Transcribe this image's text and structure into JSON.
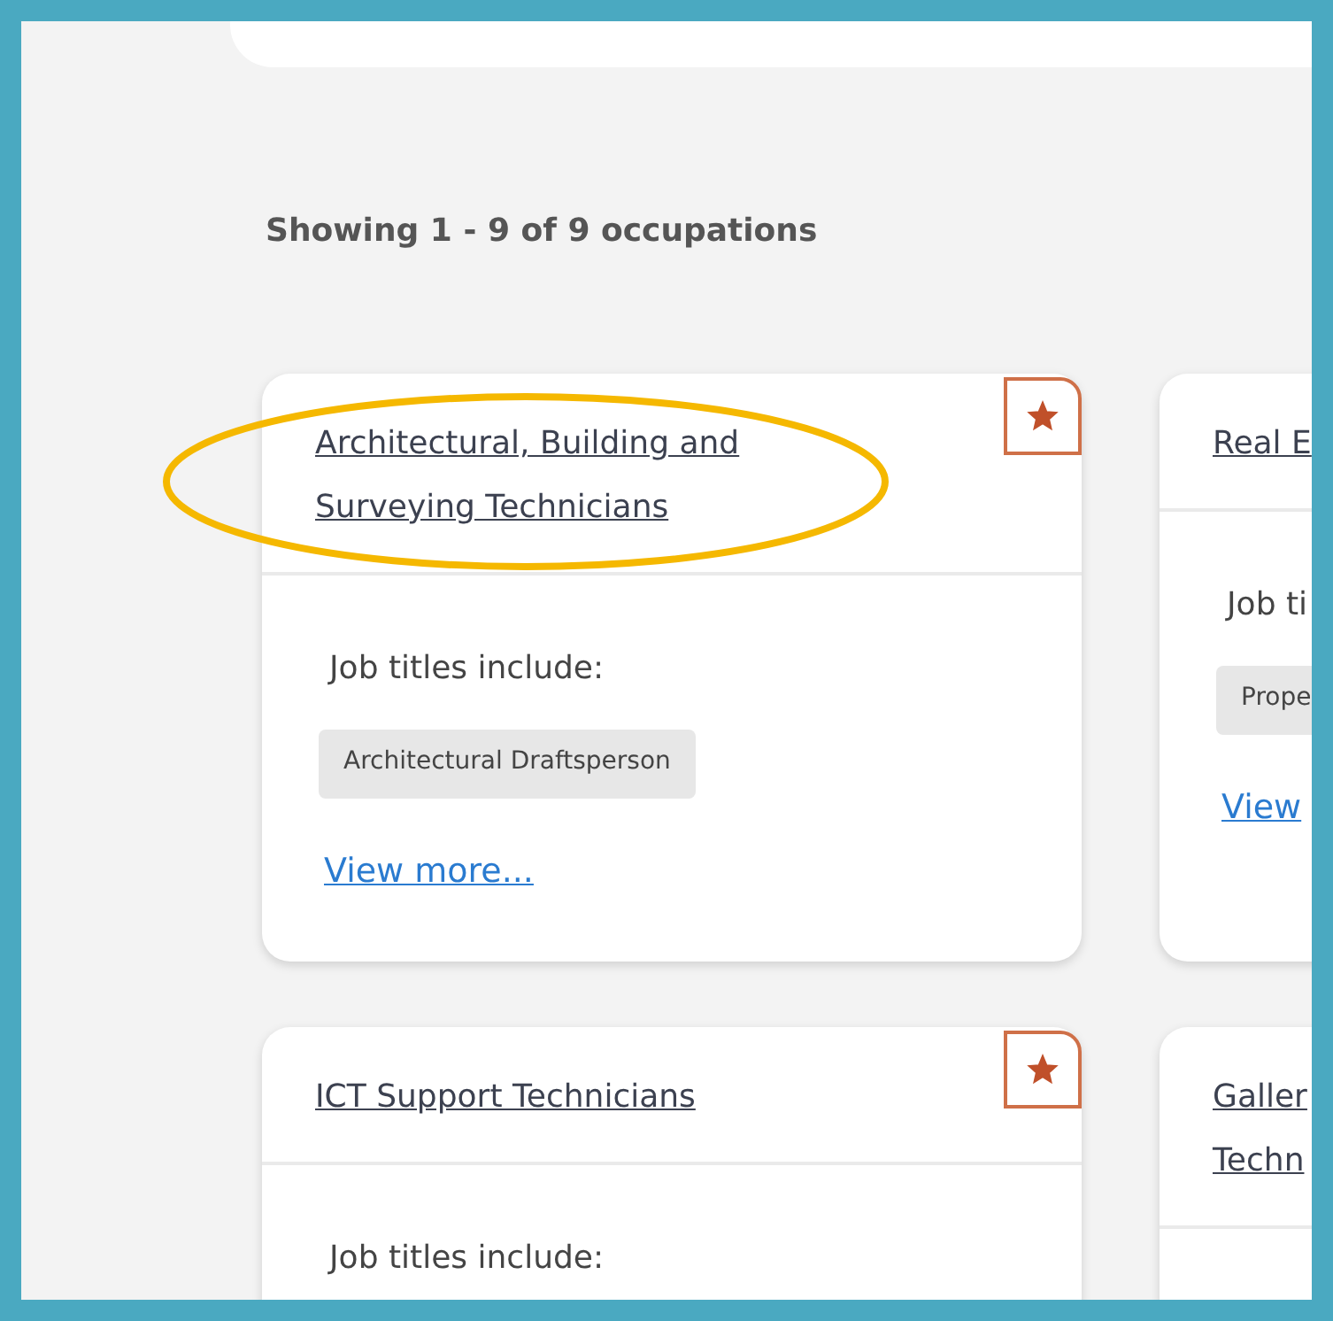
{
  "results_summary": "Showing 1 - 9 of 9 occupations",
  "cards": [
    {
      "title_lines": [
        "Architectural, Building and",
        "Surveying Technicians"
      ],
      "favorite": true,
      "highlighted": true,
      "job_titles_label": "Job titles include:",
      "job_titles": [
        "Architectural Draftsperson"
      ],
      "link": "View more..."
    },
    {
      "title_lines": [
        "Real E"
      ],
      "job_titles_label": "Job ti",
      "job_titles": [
        "Prope"
      ],
      "link": "View"
    },
    {
      "title_lines": [
        "ICT Support Technicians"
      ],
      "favorite": true,
      "job_titles_label": "Job titles include:"
    },
    {
      "title_lines": [
        "Galler",
        "Techn"
      ]
    }
  ]
}
